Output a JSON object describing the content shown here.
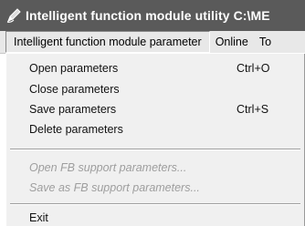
{
  "window": {
    "title": "Intelligent function module utility C:\\ME"
  },
  "menubar": {
    "items": [
      {
        "label": "Intelligent function module parameter",
        "active": true
      },
      {
        "label": "Online"
      },
      {
        "label": "To"
      }
    ]
  },
  "dropdown": {
    "items": [
      {
        "label": "Open parameters",
        "shortcut": "Ctrl+O",
        "enabled": true
      },
      {
        "label": "Close parameters",
        "shortcut": "",
        "enabled": true
      },
      {
        "label": "Save parameters",
        "shortcut": "Ctrl+S",
        "enabled": true
      },
      {
        "label": "Delete parameters",
        "shortcut": "",
        "enabled": true
      },
      {
        "label": "Open FB support parameters...",
        "shortcut": "",
        "enabled": false
      },
      {
        "label": "Save as FB support parameters...",
        "shortcut": "",
        "enabled": false
      },
      {
        "label": "Exit",
        "shortcut": "",
        "enabled": true
      }
    ]
  }
}
